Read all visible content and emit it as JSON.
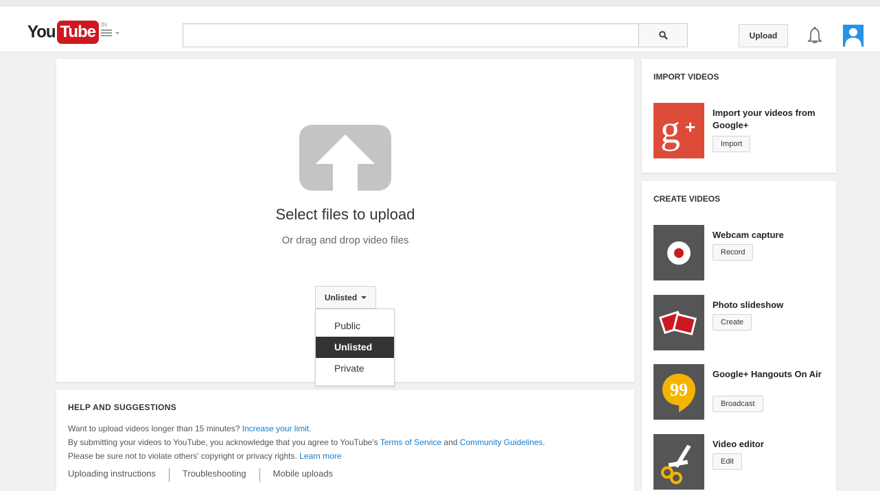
{
  "header": {
    "logo_you": "You",
    "logo_tube": "Tube",
    "logo_country": "IN",
    "search_value": "",
    "upload_label": "Upload"
  },
  "upload": {
    "title": "Select files to upload",
    "subtitle": "Or drag and drop video files",
    "privacy_selected": "Unlisted",
    "privacy_options": [
      "Public",
      "Unlisted",
      "Private"
    ]
  },
  "help": {
    "title": "HELP AND SUGGESTIONS",
    "line1_text": "Want to upload videos longer than 15 minutes?",
    "line1_link": "Increase your limit.",
    "line2_text": "By submitting your videos to YouTube, you acknowledge that you agree to YouTube's",
    "line2_link1": "Terms of Service",
    "line2_and": "and",
    "line2_link2": "Community Guidelines.",
    "line3_text": "Please be sure not to violate others' copyright or privacy rights.",
    "line3_link": "Learn more",
    "links": [
      "Uploading instructions",
      "Troubleshooting",
      "Mobile uploads"
    ]
  },
  "sidebar": {
    "import_title": "IMPORT VIDEOS",
    "import_item": {
      "label": "Import your videos from Google+",
      "button": "Import"
    },
    "create_title": "CREATE VIDEOS",
    "create_items": [
      {
        "label": "Webcam capture",
        "button": "Record",
        "icon": "record-icon"
      },
      {
        "label": "Photo slideshow",
        "button": "Create",
        "icon": "photos-icon"
      },
      {
        "label": "Google+ Hangouts On Air",
        "button": "Broadcast",
        "icon": "hangouts-icon"
      },
      {
        "label": "Video editor",
        "button": "Edit",
        "icon": "scissors-icon"
      }
    ]
  },
  "colors": {
    "brand_red": "#cc181e",
    "link_blue": "#167ac6",
    "google_plus_red": "#dd4b39",
    "hangouts_yellow": "#f4b400"
  }
}
